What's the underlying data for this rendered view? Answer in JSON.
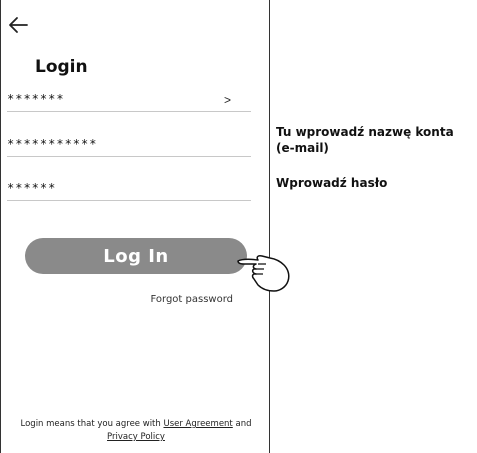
{
  "header": {
    "back_icon": "back-arrow-icon"
  },
  "title": "Login",
  "fields": [
    {
      "value": "*******",
      "chevron": ">"
    },
    {
      "value": "***********"
    },
    {
      "value": "******"
    }
  ],
  "login_button": {
    "label": "Log In",
    "color": "#8a8a8a"
  },
  "forgot_password": "Forgot password",
  "agreement": {
    "prefix": "Login means that you agree with ",
    "user_agreement": "User Agreement",
    "and": " and",
    "privacy_policy": "Privacy Policy"
  },
  "annotations": {
    "account_hint": "Tu wprowadź nazwę konta (e-mail)",
    "password_hint": "Wprowadź hasło"
  }
}
